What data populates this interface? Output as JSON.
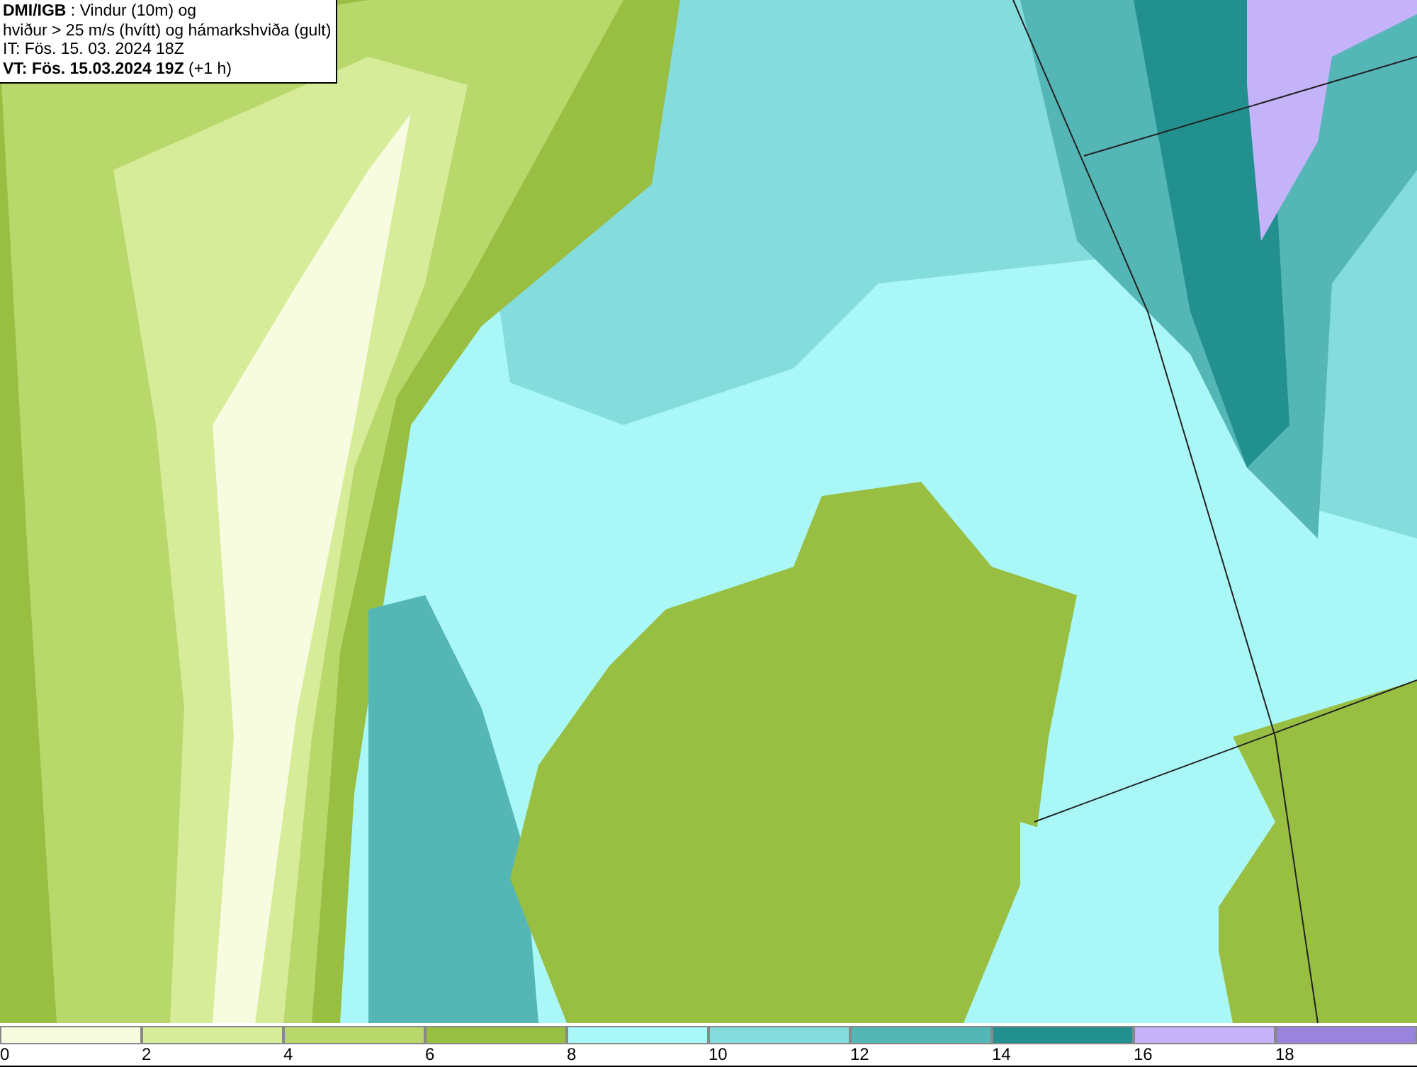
{
  "title_box": {
    "lines": [
      "**DMI/IGB** : Vindur (10m) og",
      "hviður > 25 m/s (hvítt) og hámarkshviða (gult)",
      "IT: Fös. 15. 03. 2024 18Z",
      "**VT: Fös. 15.03.2024 19Z** (+1 h)"
    ]
  },
  "colorbar": [
    {
      "label": "0",
      "color": "#f7fce0"
    },
    {
      "label": "2",
      "color": "#d7ec98"
    },
    {
      "label": "4",
      "color": "#b8d86c"
    },
    {
      "label": "6",
      "color": "#98bf42"
    },
    {
      "label": "8",
      "color": "#aaf7f8"
    },
    {
      "label": "10",
      "color": "#84dcdc"
    },
    {
      "label": "12",
      "color": "#55b6b6"
    },
    {
      "label": "14",
      "color": "#239090"
    },
    {
      "label": "16",
      "color": "#c5b3fa"
    },
    {
      "label": "18",
      "color": "#9884dc"
    }
  ]
}
